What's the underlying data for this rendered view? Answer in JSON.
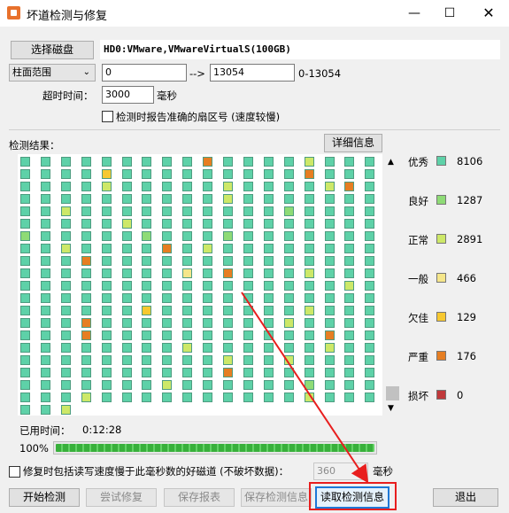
{
  "window": {
    "title": "坏道检测与修复",
    "min_icon": "minimize-icon",
    "max_icon": "maximize-icon",
    "close_icon": "close-icon"
  },
  "disk": {
    "select_button": "选择磁盘",
    "disk_name": "HD0:VMware,VMwareVirtualS(100GB)"
  },
  "range": {
    "mode": "柱面范围",
    "start": "0",
    "arrow": "-->",
    "end": "13054",
    "hint": "0-13054"
  },
  "timeout": {
    "label": "超时时间：",
    "value": "3000",
    "unit": "毫秒"
  },
  "report_sector": {
    "label": "检测时报告准确的扇区号 (速度较慢)",
    "checked": false
  },
  "results": {
    "label": "检测结果：",
    "details_button": "详细信息"
  },
  "legend": [
    {
      "name": "优秀",
      "count": "8106",
      "color": "#5ed1a8"
    },
    {
      "name": "良好",
      "count": "1287",
      "color": "#8edb76"
    },
    {
      "name": "正常",
      "count": "2891",
      "color": "#cde868"
    },
    {
      "name": "一般",
      "count": "466",
      "color": "#f5e68a"
    },
    {
      "name": "欠佳",
      "count": "129",
      "color": "#f7c830"
    },
    {
      "name": "严重",
      "count": "176",
      "color": "#e67e22"
    },
    {
      "name": "损坏",
      "count": "0",
      "color": "#c0393b"
    }
  ],
  "elapsed": {
    "label": "已用时间：",
    "value": "0:12:28"
  },
  "progress": {
    "label": "100%",
    "fraction": 1.0
  },
  "slow_repair": {
    "label": "修复时包括读写速度慢于此毫秒数的好磁道 (不破坏数据)：",
    "value": "360",
    "unit": "毫秒",
    "checked": false
  },
  "buttons": {
    "start": "开始检测",
    "try_repair": "尝试修复",
    "save_report": "保存报表",
    "save_info": "保存检测信息",
    "read_info": "读取检测信息",
    "exit": "退出"
  },
  "annotation_color": "#e81e1e"
}
